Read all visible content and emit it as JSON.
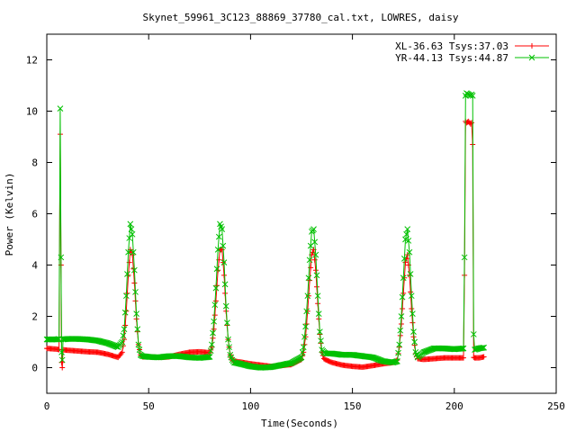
{
  "chart_data": {
    "type": "line",
    "title": "Skynet_59961_3C123_88869_37780_cal.txt, LOWRES, daisy",
    "xlabel": "Time(Seconds)",
    "ylabel": "Power (Kelvin)",
    "xlim": [
      0,
      250
    ],
    "ylim": [
      -1,
      13
    ],
    "xticks": [
      0,
      50,
      100,
      150,
      200,
      250
    ],
    "yticks": [
      0,
      2,
      4,
      6,
      8,
      10,
      12
    ],
    "grid": false,
    "legend_position": "top-right",
    "series": [
      {
        "name": "XL-36.63 Tsys:37.03",
        "color": "#ff0000",
        "marker": "plus",
        "x": [
          0,
          5,
          6,
          6.6,
          7,
          7.3,
          7.6,
          8,
          10,
          15,
          20,
          25,
          30,
          35,
          37,
          38,
          39,
          40,
          41,
          42,
          43,
          44,
          45,
          46,
          47,
          50,
          55,
          60,
          65,
          70,
          75,
          80,
          81,
          82,
          83,
          84,
          85,
          86,
          87,
          88,
          89,
          90,
          91,
          92,
          95,
          100,
          105,
          110,
          115,
          120,
          125,
          126,
          127,
          128,
          129,
          130,
          131,
          132,
          133,
          134,
          135,
          136,
          137,
          140,
          145,
          150,
          155,
          160,
          165,
          170,
          172,
          173,
          174,
          175,
          176,
          177,
          178,
          179,
          180,
          181,
          182,
          185,
          190,
          195,
          200,
          204.5,
          205,
          205.5,
          206,
          207,
          208,
          208.5,
          209,
          209.5,
          210,
          212,
          214.5
        ],
        "y": [
          0.75,
          0.72,
          0.7,
          9.1,
          4.0,
          0.2,
          0.0,
          0.7,
          0.68,
          0.65,
          0.62,
          0.6,
          0.52,
          0.4,
          0.6,
          1.1,
          2.2,
          3.6,
          4.6,
          4.4,
          3.3,
          1.9,
          0.9,
          0.5,
          0.42,
          0.42,
          0.4,
          0.42,
          0.52,
          0.6,
          0.62,
          0.58,
          0.8,
          1.5,
          2.6,
          3.8,
          4.6,
          4.6,
          3.6,
          2.2,
          1.1,
          0.5,
          0.3,
          0.25,
          0.22,
          0.15,
          0.1,
          0.05,
          0.08,
          0.12,
          0.32,
          0.6,
          1.2,
          2.2,
          3.4,
          4.4,
          4.6,
          3.8,
          2.5,
          1.3,
          0.6,
          0.35,
          0.3,
          0.2,
          0.1,
          0.05,
          0.02,
          0.08,
          0.15,
          0.2,
          0.3,
          0.8,
          1.7,
          2.9,
          4.1,
          4.4,
          3.6,
          2.3,
          1.2,
          0.55,
          0.35,
          0.32,
          0.35,
          0.38,
          0.38,
          0.38,
          3.6,
          9.6,
          9.55,
          9.6,
          9.5,
          9.55,
          8.7,
          0.4,
          0.38,
          0.38,
          0.42
        ]
      },
      {
        "name": "YR-44.13 Tsys:44.87",
        "color": "#00c000",
        "marker": "cross",
        "x": [
          0,
          5,
          6,
          6.6,
          7,
          7.3,
          7.6,
          8,
          10,
          15,
          20,
          25,
          30,
          35,
          37,
          38,
          39,
          40,
          41,
          42,
          43,
          44,
          45,
          46,
          47,
          50,
          55,
          60,
          65,
          70,
          75,
          80,
          81,
          82,
          83,
          84,
          85,
          86,
          87,
          88,
          89,
          90,
          91,
          92,
          95,
          100,
          105,
          110,
          115,
          120,
          125,
          126,
          127,
          128,
          129,
          130,
          131,
          132,
          133,
          134,
          135,
          136,
          137,
          140,
          145,
          150,
          155,
          160,
          165,
          170,
          172,
          173,
          174,
          175,
          176,
          177,
          178,
          179,
          180,
          181,
          182,
          185,
          190,
          195,
          200,
          204.5,
          205,
          205.5,
          206,
          207,
          208,
          208.5,
          209,
          209.5,
          210,
          212,
          214.5
        ],
        "y": [
          1.1,
          1.1,
          1.12,
          10.1,
          4.3,
          0.6,
          0.3,
          1.1,
          1.12,
          1.12,
          1.1,
          1.05,
          0.95,
          0.8,
          1.0,
          1.5,
          2.8,
          4.5,
          5.6,
          5.2,
          3.8,
          2.1,
          0.9,
          0.5,
          0.45,
          0.42,
          0.4,
          0.45,
          0.45,
          0.4,
          0.38,
          0.42,
          0.9,
          1.8,
          3.1,
          4.6,
          5.6,
          5.4,
          4.1,
          2.4,
          1.1,
          0.5,
          0.3,
          0.2,
          0.15,
          0.05,
          0.0,
          0.02,
          0.1,
          0.18,
          0.4,
          0.8,
          1.6,
          2.8,
          4.2,
          5.3,
          5.4,
          4.4,
          2.8,
          1.4,
          0.7,
          0.6,
          0.55,
          0.55,
          0.5,
          0.5,
          0.45,
          0.4,
          0.25,
          0.2,
          0.25,
          0.9,
          2.0,
          3.5,
          5.0,
          5.4,
          4.5,
          2.8,
          1.4,
          0.6,
          0.4,
          0.6,
          0.75,
          0.75,
          0.72,
          0.75,
          4.3,
          10.6,
          10.7,
          10.65,
          10.6,
          10.65,
          10.6,
          1.3,
          0.7,
          0.75,
          0.78
        ]
      }
    ]
  }
}
